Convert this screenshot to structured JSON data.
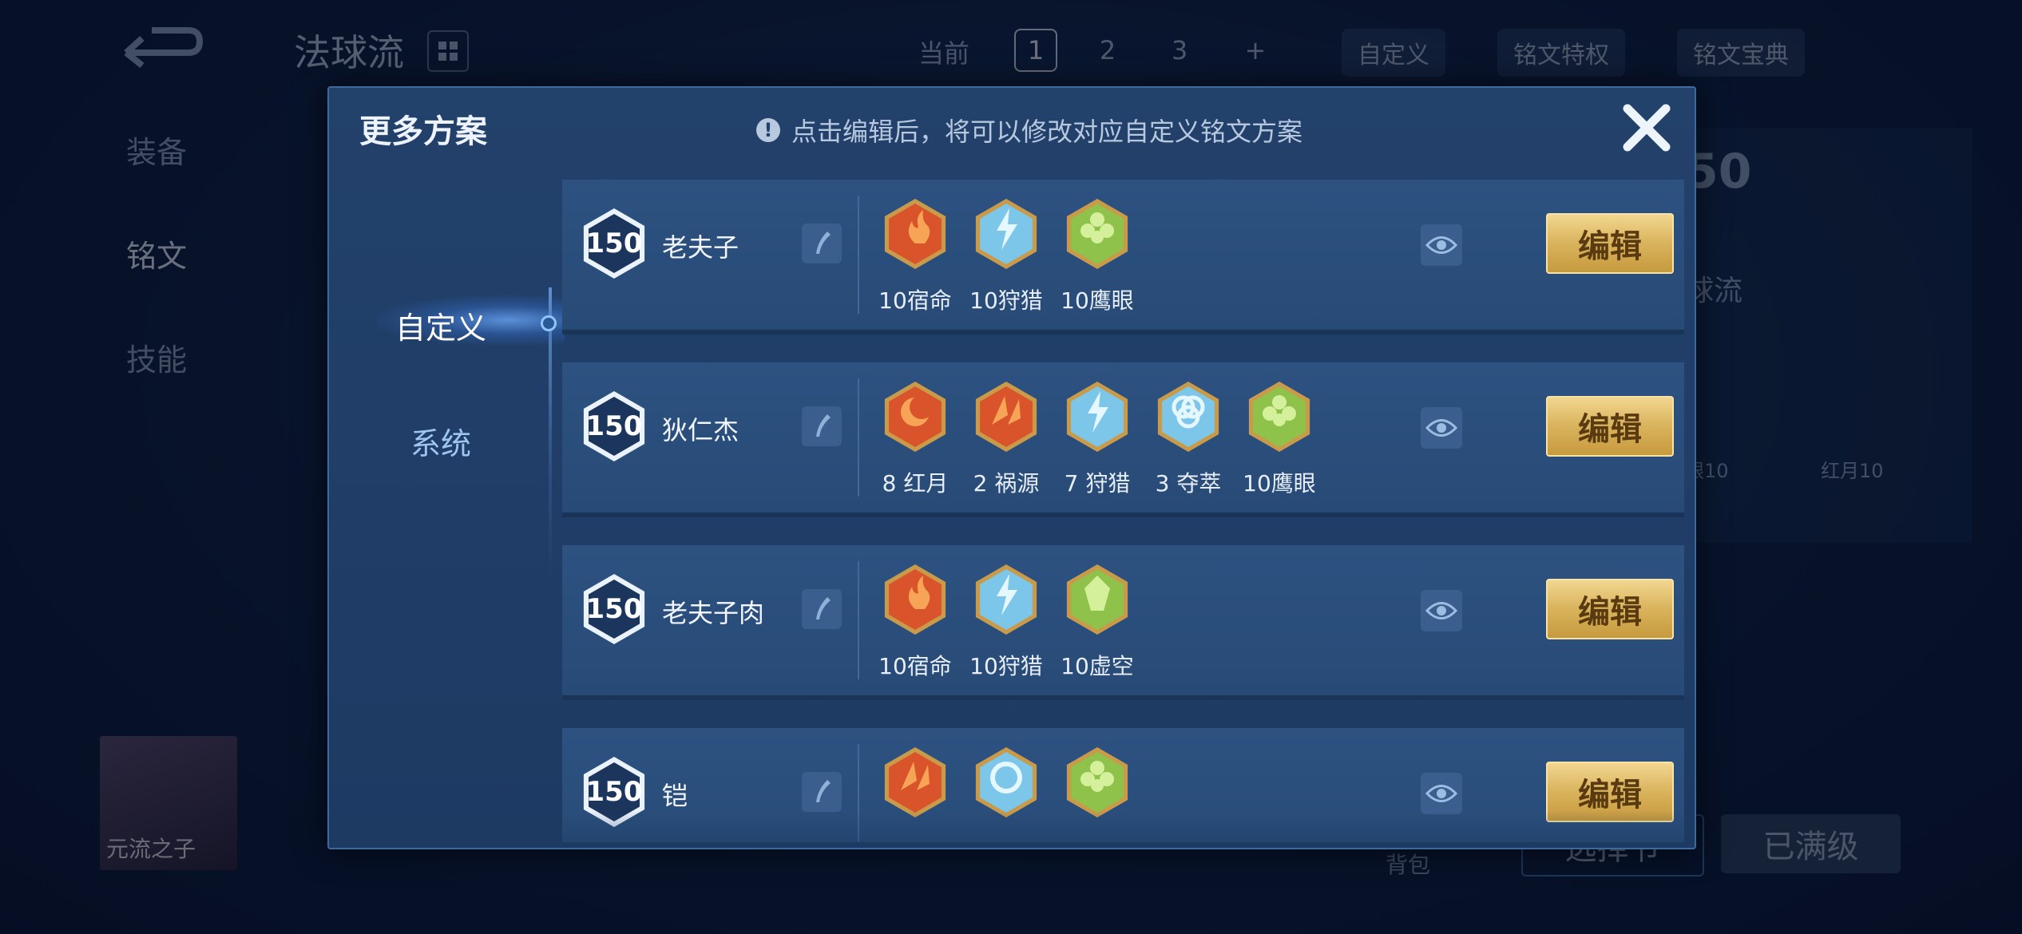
{
  "topbar": {
    "preset_name": "法球流",
    "current_label": "当前",
    "slots": [
      "1",
      "2",
      "3",
      "+"
    ],
    "custom_label": "自定义",
    "privilege_label": "铭文特权",
    "codex_label": "铭文宝典"
  },
  "sidebar": {
    "items": [
      {
        "label": "装备"
      },
      {
        "label": "铭文"
      },
      {
        "label": "技能"
      }
    ]
  },
  "right_panel": {
    "level": "50",
    "name": "球流",
    "rune_labels": [
      "眼10",
      "红月10"
    ]
  },
  "hero": {
    "name": "元流之子"
  },
  "bottom": {
    "bag_label": "背包",
    "btn_select": "选择节",
    "btn_max": "已满级"
  },
  "modal": {
    "title": "更多方案",
    "hint": "点击编辑后，将可以修改对应自定义铭文方案",
    "tabs": [
      "自定义",
      "系统"
    ],
    "edit_label": "编辑",
    "plans": [
      {
        "level": "150",
        "name": "老夫子",
        "runes": [
          {
            "label": "10宿命",
            "type": "red-flame"
          },
          {
            "label": "10狩猎",
            "type": "blue-lightning"
          },
          {
            "label": "10鹰眼",
            "type": "green-clover"
          }
        ]
      },
      {
        "level": "150",
        "name": "狄仁杰",
        "runes": [
          {
            "label": "8 红月",
            "type": "red-moon"
          },
          {
            "label": "2 祸源",
            "type": "red-shards"
          },
          {
            "label": "7 狩猎",
            "type": "blue-lightning"
          },
          {
            "label": "3 夺萃",
            "type": "blue-knot"
          },
          {
            "label": "10鹰眼",
            "type": "green-clover"
          }
        ]
      },
      {
        "level": "150",
        "name": "老夫子肉",
        "runes": [
          {
            "label": "10宿命",
            "type": "red-flame"
          },
          {
            "label": "10狩猎",
            "type": "blue-lightning"
          },
          {
            "label": "10虚空",
            "type": "green-void"
          }
        ]
      },
      {
        "level": "150",
        "name": "铠",
        "runes": [
          {
            "label": "",
            "type": "red-shards"
          },
          {
            "label": "",
            "type": "blue-ring"
          },
          {
            "label": "",
            "type": "green-clover"
          }
        ]
      }
    ]
  },
  "colors": {
    "red": "#d9542a",
    "blue": "#7cc6ea",
    "green": "#8fc24a",
    "gold": "#d9b35c"
  }
}
